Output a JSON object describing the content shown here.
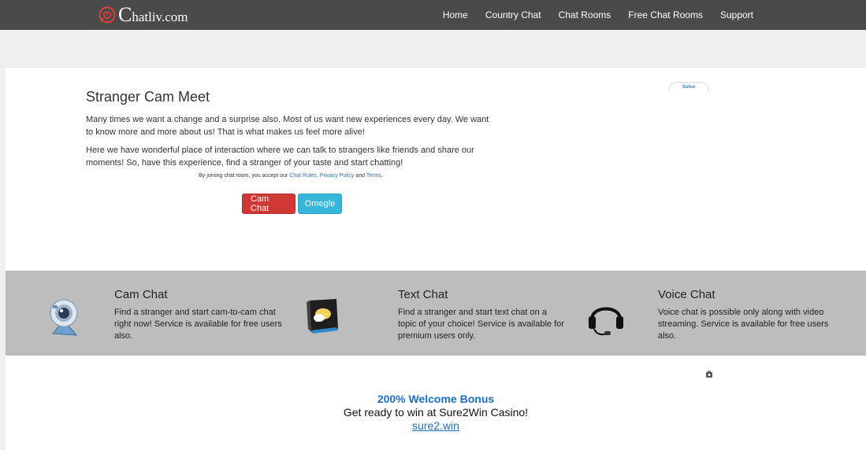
{
  "header": {
    "logo_letter": "C",
    "logo_rest": "hatliv.com",
    "nav": [
      "Home",
      "Country Chat",
      "Chat Rooms",
      "Free Chat Rooms",
      "Support"
    ]
  },
  "hero": {
    "title": "Stranger Cam Meet",
    "para1": "Many times we want a change and a surprise also. Most of us want new experiences every day. We want to know more and more about us! That is what makes us feel more alive!",
    "para2": "Here we have wonderful place of interaction where we can talk to strangers like friends and share our moments! So, have this experience, find a stranger of your taste and start chatting!",
    "terms_prefix": "By joining chat room, you accept our",
    "terms_rules": "Chat Rules",
    "terms_comma": ",",
    "terms_privacy": "Privacy Policy",
    "terms_and": "and",
    "terms_terms": "Terms",
    "terms_dot": ".",
    "btn_cam": "Cam Chat",
    "btn_omegle": "Omegle"
  },
  "sulvo": "Sulvo",
  "features": [
    {
      "title": "Cam Chat",
      "desc": "Find a stranger and start cam-to-cam chat right now! Service is available for free users also.",
      "icon": "webcam-icon"
    },
    {
      "title": "Text Chat",
      "desc": "Find a stranger and start text chat on a topic of your choice! Service is available for premium users only.",
      "icon": "chat-bubble-icon"
    },
    {
      "title": "Voice Chat",
      "desc": "Voice chat is possible only along with video streaming. Service is available for free users also.",
      "icon": "headset-icon"
    }
  ],
  "promo": {
    "title": "200% Welcome Bonus",
    "text": "Get ready to win at Sure2Win Casino!",
    "link": "sure2.win"
  },
  "colors": {
    "topbar": "#4a4a4a",
    "features_band": "#bdbdbd",
    "cam_button": "#cf3734",
    "omegle_button": "#36b6d9",
    "link": "#1a6fc4"
  }
}
